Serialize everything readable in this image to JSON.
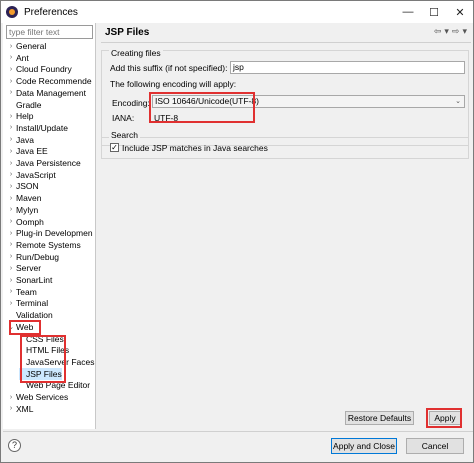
{
  "window": {
    "title": "Preferences",
    "minimize": "—",
    "maximize": "☐",
    "close": "✕"
  },
  "filter": {
    "placeholder": "type filter text"
  },
  "tree": [
    {
      "label": "General",
      "arrow": "›",
      "indent": 0
    },
    {
      "label": "Ant",
      "arrow": "›",
      "indent": 0
    },
    {
      "label": "Cloud Foundry",
      "arrow": "›",
      "indent": 0
    },
    {
      "label": "Code Recommende",
      "arrow": "›",
      "indent": 0
    },
    {
      "label": "Data Management",
      "arrow": "›",
      "indent": 0
    },
    {
      "label": "Gradle",
      "arrow": "",
      "indent": 0
    },
    {
      "label": "Help",
      "arrow": "›",
      "indent": 0
    },
    {
      "label": "Install/Update",
      "arrow": "›",
      "indent": 0
    },
    {
      "label": "Java",
      "arrow": "›",
      "indent": 0
    },
    {
      "label": "Java EE",
      "arrow": "›",
      "indent": 0
    },
    {
      "label": "Java Persistence",
      "arrow": "›",
      "indent": 0
    },
    {
      "label": "JavaScript",
      "arrow": "›",
      "indent": 0
    },
    {
      "label": "JSON",
      "arrow": "›",
      "indent": 0
    },
    {
      "label": "Maven",
      "arrow": "›",
      "indent": 0
    },
    {
      "label": "Mylyn",
      "arrow": "›",
      "indent": 0
    },
    {
      "label": "Oomph",
      "arrow": "›",
      "indent": 0
    },
    {
      "label": "Plug-in Developmen",
      "arrow": "›",
      "indent": 0
    },
    {
      "label": "Remote Systems",
      "arrow": "›",
      "indent": 0
    },
    {
      "label": "Run/Debug",
      "arrow": "›",
      "indent": 0
    },
    {
      "label": "Server",
      "arrow": "›",
      "indent": 0
    },
    {
      "label": "SonarLint",
      "arrow": "›",
      "indent": 0
    },
    {
      "label": "Team",
      "arrow": "›",
      "indent": 0
    },
    {
      "label": "Terminal",
      "arrow": "›",
      "indent": 0
    },
    {
      "label": "Validation",
      "arrow": "",
      "indent": 0
    },
    {
      "label": "Web",
      "arrow": "⌄",
      "indent": 0
    },
    {
      "label": "CSS Files",
      "arrow": "",
      "indent": 1
    },
    {
      "label": "HTML Files",
      "arrow": "",
      "indent": 1
    },
    {
      "label": "JavaServer Faces",
      "arrow": "",
      "indent": 1
    },
    {
      "label": "JSP Files",
      "arrow": "",
      "indent": 1,
      "selected": true
    },
    {
      "label": "Web Page Editor",
      "arrow": "",
      "indent": 1
    },
    {
      "label": "Web Services",
      "arrow": "›",
      "indent": 0
    },
    {
      "label": "XML",
      "arrow": "›",
      "indent": 0
    }
  ],
  "page": {
    "title": "JSP Files",
    "nav_back": "⇦",
    "nav_back_menu": "▾",
    "nav_forward": "⇨",
    "nav_forward_menu": "▾",
    "creating_files_label": "Creating files",
    "suffix_label": "Add this suffix (if not specified):",
    "suffix_value": "jsp",
    "encoding_info": "The following encoding will apply:",
    "encoding_label": "Encoding:",
    "encoding_value": "ISO 10646/Unicode(UTF-8)",
    "iana_label": "IANA:",
    "iana_value": "UTF-8",
    "search_label": "Search",
    "include_jsp_label": "Include JSP matches in Java searches",
    "include_jsp_checked": "✓",
    "dropdown_arrow": "⌄"
  },
  "buttons": {
    "restore_defaults": "Restore Defaults",
    "apply": "Apply",
    "apply_and_close": "Apply and Close",
    "cancel": "Cancel"
  },
  "help": {
    "icon": "?"
  },
  "colors": {
    "highlight": "#e03030",
    "selection": "#cce8ff",
    "primary_border": "#0078d7"
  }
}
